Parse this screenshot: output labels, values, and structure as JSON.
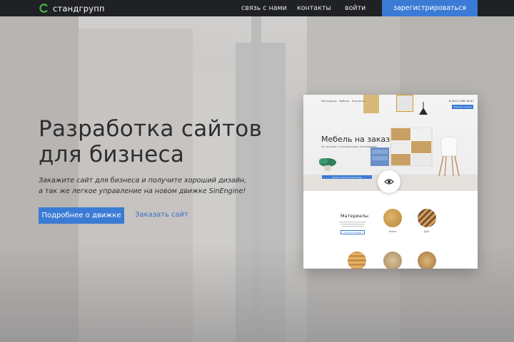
{
  "header": {
    "logo_text": "стандгрупп",
    "nav": [
      "связь с нами",
      "контакты",
      "войти"
    ],
    "register_label": "зарегистрироваться"
  },
  "hero": {
    "headline_lines": [
      "Разработка сайтов",
      "для бизнеса"
    ],
    "lead_lines": [
      "Закажите сайт для бизнеса и получите хороший дизайн,",
      "а так же легкое управление на новом движке SinEngine!"
    ],
    "primary_button": "Подробнее о движке",
    "secondary_link": "Заказать сайт"
  },
  "mockup": {
    "nav": [
      "Материалы",
      "Мебель",
      "Контакты"
    ],
    "phone": "8 (912) 456-78-87",
    "header_button": "Заказать звонок",
    "title": "Мебель на заказ",
    "subtitle": "Из лучших и натуральных материалов",
    "cta": "Заказать бесплатный замер",
    "materials_title": "Материалы",
    "materials_button": "Узнать больше",
    "swatch_labels": [
      "Ясень",
      "Дуб"
    ]
  },
  "colors": {
    "accent": "#3a7bd5",
    "topbar": "#1f2124",
    "logo_green": "#4fb94a"
  }
}
